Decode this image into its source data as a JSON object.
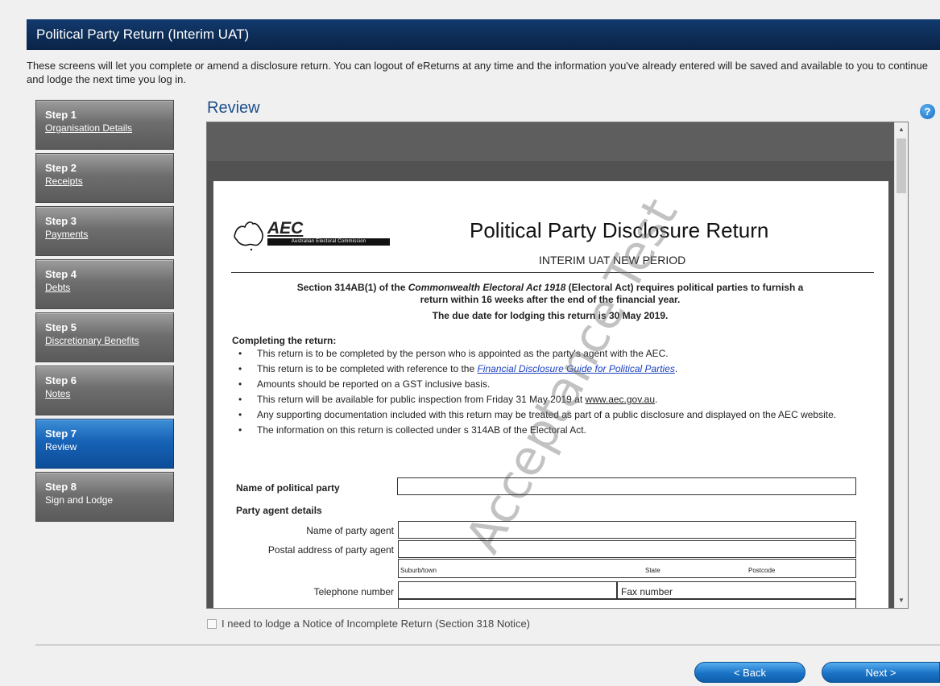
{
  "window": {
    "title": "Political Party Return (Interim UAT)"
  },
  "intro": "These screens will let you complete or amend a disclosure return. You can logout of eReturns at any time and the information you've already entered will be saved and available to you to continue and lodge the next time you log in.",
  "steps": [
    {
      "num": "Step 1",
      "label": "Organisation Details",
      "active": false
    },
    {
      "num": "Step 2",
      "label": "Receipts",
      "active": false
    },
    {
      "num": "Step 3",
      "label": "Payments",
      "active": false
    },
    {
      "num": "Step 4",
      "label": "Debts",
      "active": false
    },
    {
      "num": "Step 5",
      "label": "Discretionary Benefits",
      "active": false
    },
    {
      "num": "Step 6",
      "label": "Notes",
      "active": false
    },
    {
      "num": "Step 7",
      "label": "Review",
      "active": true
    },
    {
      "num": "Step 8",
      "label": "Sign and Lodge",
      "active": false
    }
  ],
  "review": {
    "title": "Review",
    "help_icon": "?"
  },
  "document": {
    "logo_text": "AEC",
    "logo_sub": "Australian Electoral Commission",
    "title": "Political Party Disclosure Return",
    "subtitle": "INTERIM UAT NEW PERIOD",
    "section_a": "Section 314AB(1) of the ",
    "section_act": "Commonwealth Electoral Act 1918",
    "section_b": " (Electoral Act) requires political parties to furnish a",
    "section_line2": "return within 16 weeks after the end of the financial year.",
    "due_date": "The due date for lodging this return is 30 May 2019.",
    "completing_heading": "Completing the return:",
    "bullet1": "This return is to be completed by the person who is appointed as the party's agent with the AEC.",
    "bullet2_a": "This return is to be completed with reference to the ",
    "bullet2_link": "Financial Disclosure Guide for Political Parties",
    "bullet2_b": ".",
    "bullet3": "Amounts should be reported on a GST inclusive basis.",
    "bullet4_a": "This return will be available for public inspection from Friday 31 May 2019 at ",
    "bullet4_link": "www.aec.gov.au",
    "bullet4_b": ".",
    "bullet5": "Any supporting documentation included with this return may be treated as part of a public disclosure and displayed on the AEC website.",
    "bullet6": "The information on this return is collected under s 314AB of the Electoral Act.",
    "party_name_label": "Name of political party",
    "agent_details_label": "Party agent details",
    "agent_name_label": "Name of party agent",
    "postal_label": "Postal address of party agent",
    "suburb_label": "Suburb/town",
    "state_label": "State",
    "postcode_label": "Postcode",
    "telephone_label": "Telephone number",
    "fax_label": "Fax number",
    "watermark": "Acceptance Test"
  },
  "notice": "I need to lodge a Notice of Incomplete Return (Section 318 Notice)",
  "buttons": {
    "back": "< Back",
    "next": "Next >"
  }
}
